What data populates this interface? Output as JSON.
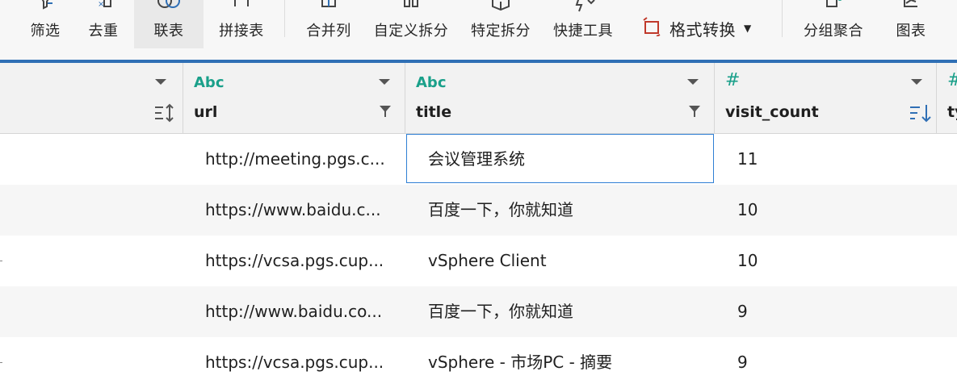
{
  "toolbar": {
    "buttons": [
      {
        "id": "filter",
        "label": "筛选",
        "icon": "filter-icon"
      },
      {
        "id": "dedupe",
        "label": "去重",
        "icon": "dedupe-icon"
      },
      {
        "id": "join",
        "label": "联表",
        "icon": "join-icon",
        "active": true
      },
      {
        "id": "append",
        "label": "拼接表",
        "icon": "append-icon"
      },
      {
        "id": "merge-cols",
        "label": "合并列",
        "icon": "merge-columns-icon"
      },
      {
        "id": "custom-split",
        "label": "自定义拆分",
        "icon": "custom-split-icon"
      },
      {
        "id": "specific-split",
        "label": "特定拆分",
        "icon": "specific-split-icon"
      },
      {
        "id": "quick-tools",
        "label": "快捷工具",
        "icon": "quick-tools-icon"
      },
      {
        "id": "group-agg",
        "label": "分组聚合",
        "icon": "group-aggregate-icon"
      },
      {
        "id": "chart",
        "label": "图表",
        "icon": "chart-icon"
      }
    ],
    "format_convert": {
      "label": "格式转换",
      "icon": "format-convert-icon"
    },
    "accent_color": "#2f6fb5"
  },
  "grid": {
    "columns": [
      {
        "key": "url",
        "name": "url",
        "type": "Abc"
      },
      {
        "key": "title",
        "name": "title",
        "type": "Abc"
      },
      {
        "key": "visit_count",
        "name": "visit_count",
        "type": "#"
      },
      {
        "key": "ty",
        "name": "ty",
        "type": "#"
      }
    ],
    "rows": [
      {
        "url": "http://meeting.pgs.c...",
        "title": "会议管理系统",
        "visit_count": "11"
      },
      {
        "url": "https://www.baidu.c...",
        "title": "百度一下，你就知道",
        "visit_count": "10"
      },
      {
        "url": "https://vcsa.pgs.cup...",
        "title": "vSphere Client",
        "visit_count": "10"
      },
      {
        "url": "http://www.baidu.co...",
        "title": "百度一下，你就知道",
        "visit_count": "9"
      },
      {
        "url": "https://vcsa.pgs.cup...",
        "title": "vSphere - 市场PC - 摘要",
        "visit_count": "9"
      }
    ],
    "selected_cell": {
      "row": 0,
      "column": "title"
    },
    "type_color": "#1aa08a",
    "selection_color": "#2f7fd4"
  }
}
